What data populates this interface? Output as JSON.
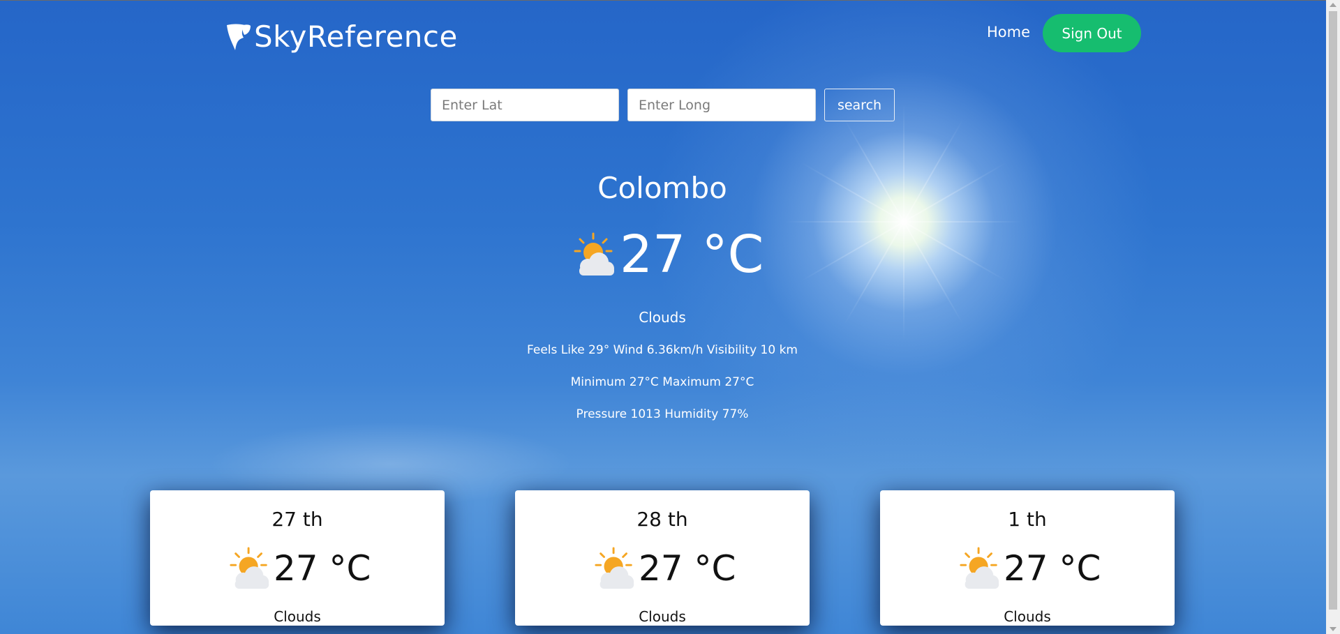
{
  "brand": {
    "name": "SkyReference"
  },
  "nav": {
    "home": "Home",
    "signout": "Sign Out"
  },
  "search": {
    "lat_placeholder": "Enter Lat",
    "long_placeholder": "Enter Long",
    "button": "search"
  },
  "current": {
    "city": "Colombo",
    "temperature": "27 °C",
    "condition": "Clouds",
    "line1": "Feels Like 29° Wind 6.36km/h Visibility 10 km",
    "line2": "Minimum 27°C Maximum 27°C",
    "line3": "Pressure 1013 Humidity 77%",
    "icon": "partly-cloudy-icon"
  },
  "forecast": [
    {
      "day": "27 th",
      "temperature": "27 °C",
      "condition": "Clouds",
      "icon": "partly-cloudy-icon"
    },
    {
      "day": "28 th",
      "temperature": "27 °C",
      "condition": "Clouds",
      "icon": "partly-cloudy-icon"
    },
    {
      "day": "1 th",
      "temperature": "27 °C",
      "condition": "Clouds",
      "icon": "partly-cloudy-icon"
    }
  ],
  "colors": {
    "accent_green": "#16bd6f",
    "sky_blue": "#2e74cf",
    "sun_orange": "#f5a623",
    "cloud_grey": "#e8eaee"
  }
}
